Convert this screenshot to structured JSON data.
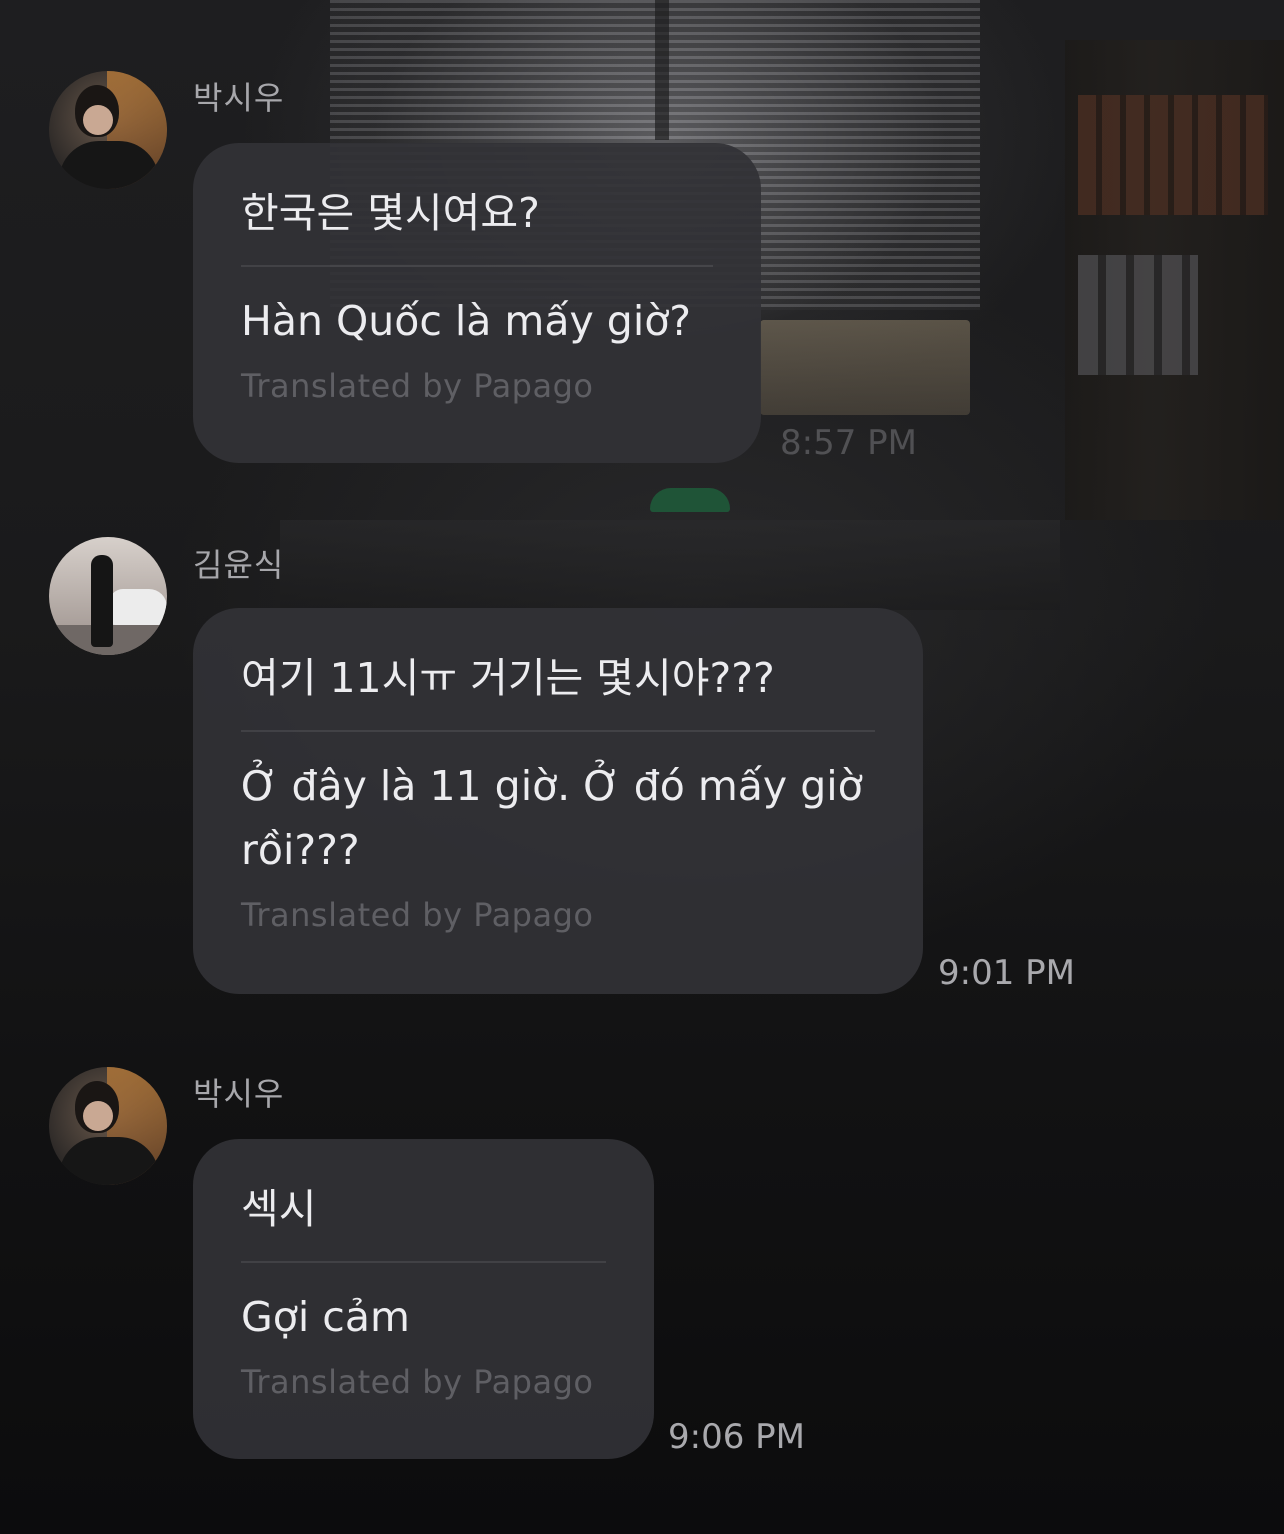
{
  "messages": [
    {
      "sender": "박시우",
      "original": "한국은 몇시여요?",
      "translation": "Hàn Quốc là mấy giờ?",
      "credit": "Translated by Papago",
      "time": "8:57 PM"
    },
    {
      "sender": "김윤식",
      "original": "여기 11시ㅠ 거기는 몇시야???",
      "translation": "Ở đây là 11 giờ. Ở đó mấy giờ rồi???",
      "credit": "Translated by Papago",
      "time": "9:01 PM"
    },
    {
      "sender": "박시우",
      "original": "섹시",
      "translation": "Gợi cảm",
      "credit": "Translated by Papago",
      "time": "9:06 PM"
    }
  ]
}
